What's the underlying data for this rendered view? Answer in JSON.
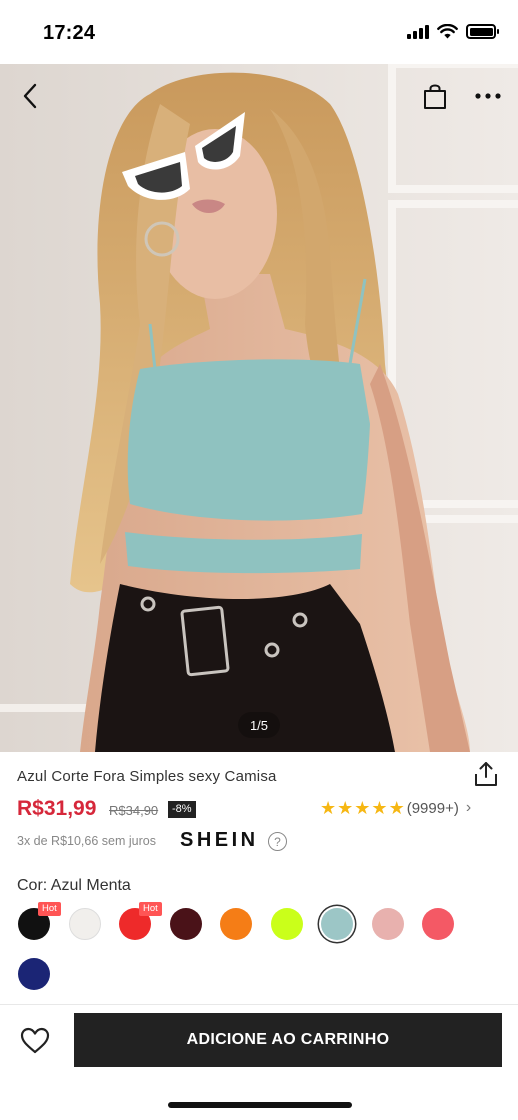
{
  "status_bar": {
    "time": "17:24"
  },
  "hero": {
    "image_counter": "1/5",
    "icons": {
      "back": "chevron-left-icon",
      "bag": "shopping-bag-icon",
      "more": "more-icon"
    }
  },
  "product": {
    "title": "Azul Corte Fora Simples sexy Camisa",
    "price": "R$31,99",
    "old_price": "R$34,90",
    "discount": "-8%",
    "rating": {
      "stars": 5,
      "count": "(9999+)"
    },
    "installments": "3x de R$10,66 sem juros",
    "brand": "SHEIN",
    "color_label": "Cor: Azul Menta",
    "colors": [
      {
        "hex": "#111111",
        "hot": "Hot"
      },
      {
        "hex": "#f1efec"
      },
      {
        "hex": "#ee2a2a",
        "hot": "Hot"
      },
      {
        "hex": "#4a1218"
      },
      {
        "hex": "#f57d16"
      },
      {
        "hex": "#caff1a"
      },
      {
        "hex": "#9cc6c6",
        "selected": true
      },
      {
        "hex": "#e8b1ae"
      },
      {
        "hex": "#f45965"
      },
      {
        "hex": "#1b2575"
      }
    ]
  },
  "bottom_bar": {
    "add_to_cart": "ADICIONE AO CARRINHO"
  }
}
